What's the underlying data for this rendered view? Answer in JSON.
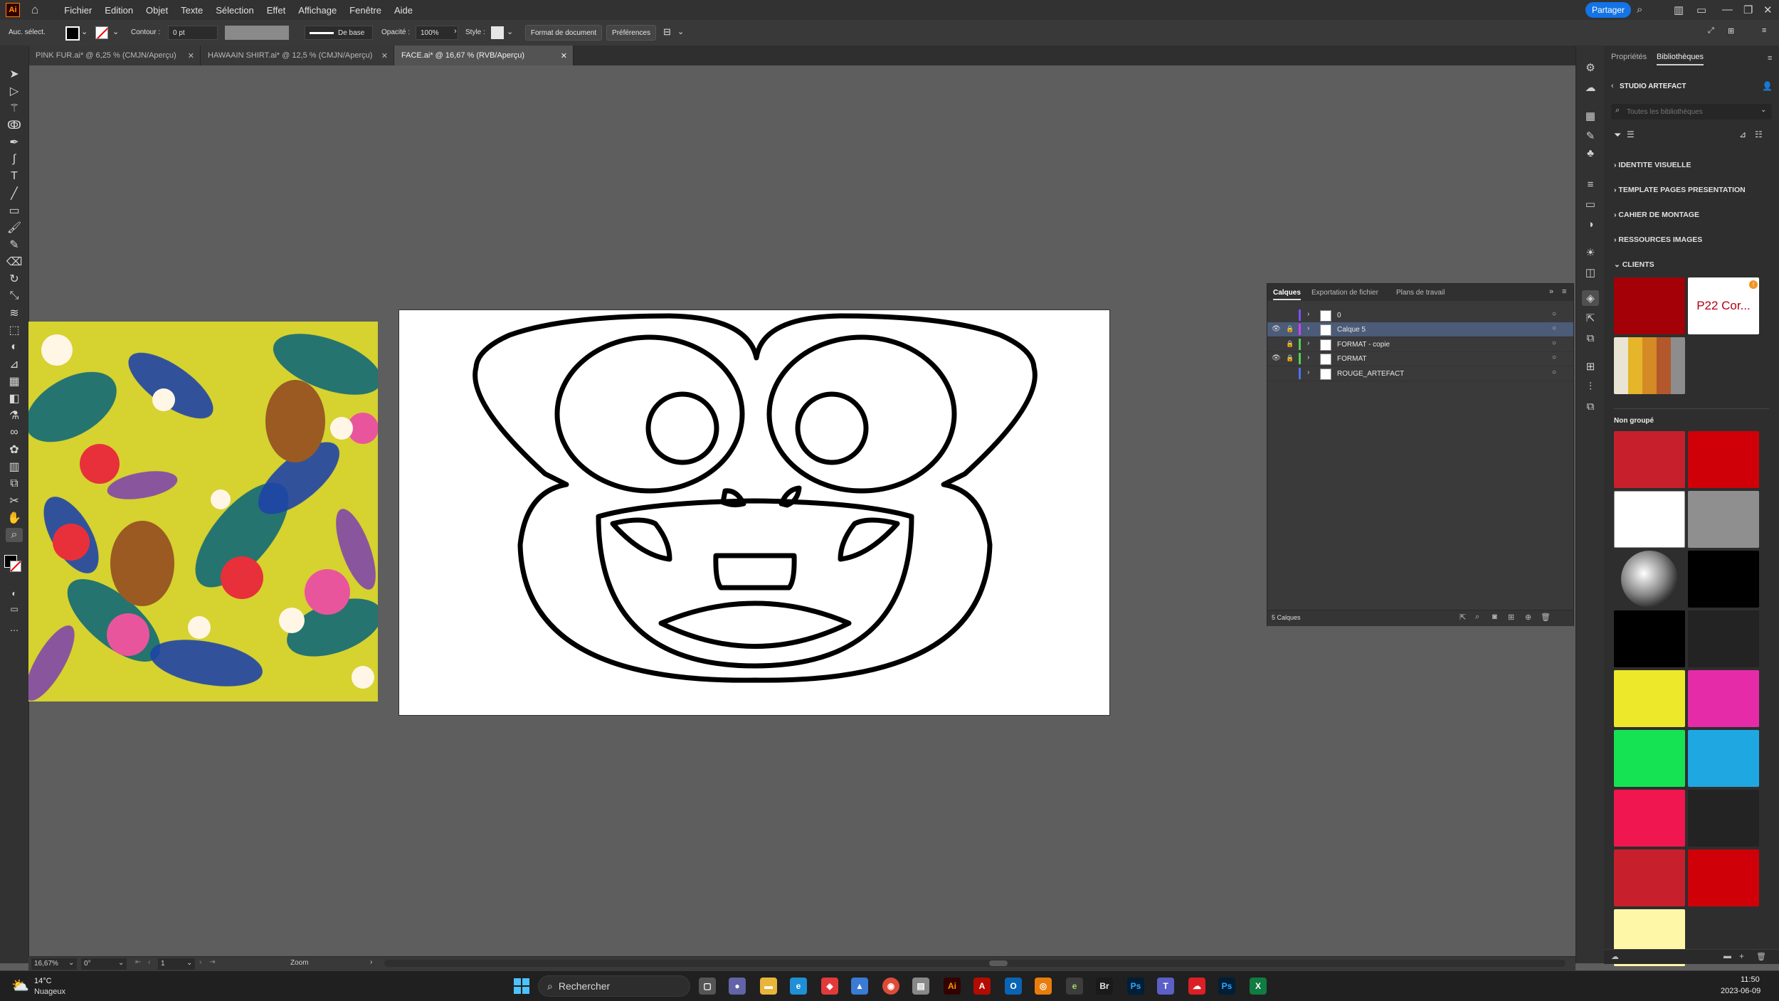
{
  "app": {
    "logo": "Ai"
  },
  "menu": [
    "Fichier",
    "Edition",
    "Objet",
    "Texte",
    "Sélection",
    "Effet",
    "Affichage",
    "Fenêtre",
    "Aide"
  ],
  "share_label": "Partager",
  "control_bar": {
    "selection_label": "Auc. sélect.",
    "contour_label": "Contour :",
    "stroke_weight": "0 pt",
    "stroke_profile": "De base",
    "opacity_label": "Opacité :",
    "opacity_value": "100%",
    "style_label": "Style :",
    "format_button": "Format de document",
    "preferences_button": "Préférences"
  },
  "doc_tabs": [
    {
      "label": "PINK FUR.ai* @ 6,25 % (CMJN/Aperçu)"
    },
    {
      "label": "HAWAAIN SHIRT.ai* @ 12,5 % (CMJN/Aperçu)"
    },
    {
      "label": "FACE.ai* @ 16,67 % (RVB/Aperçu)",
      "active": true
    }
  ],
  "right_panel": {
    "tabs": [
      "Propriétés",
      "Bibliothèques"
    ],
    "library_name": "STUDIO ARTEFACT",
    "search_placeholder": "Toutes les bibliothèques",
    "groups": [
      "IDENTITE VISUELLE",
      "TEMPLATE PAGES PRESENTATION",
      "CAHIER DE MONTAGE",
      "RESSOURCES IMAGES",
      "CLIENTS"
    ],
    "client_card_label": "P22 Cor...",
    "ungrouped_label": "Non groupé",
    "colors": {
      "client_red": "#a30008",
      "swatches": [
        "#c7202c",
        "#d00008",
        "#ffffff",
        "#8f8f8f",
        "#b5b5b5",
        "#000000",
        "#000000",
        "#232323",
        "#eee82a",
        "#e62ba8",
        "#16e354",
        "#1fa7e2",
        "#f0164f",
        "#232323",
        "#c7202c",
        "#d00008",
        "#fff7a8"
      ]
    }
  },
  "layers_panel": {
    "tabs": [
      "Calques",
      "Exportation de fichier",
      "Plans de travail"
    ],
    "layers": [
      {
        "name": "0",
        "visible": false,
        "locked": false,
        "color": "#7a50ff"
      },
      {
        "name": "Calque 5",
        "visible": true,
        "locked": true,
        "color": "#d33cff",
        "selected": true
      },
      {
        "name": "FORMAT - copie",
        "visible": false,
        "locked": true,
        "color": "#4fd14f"
      },
      {
        "name": "FORMAT",
        "visible": true,
        "locked": true,
        "color": "#4fd14f"
      },
      {
        "name": "ROUGE_ARTEFACT",
        "visible": false,
        "locked": false,
        "color": "#4f6fff"
      }
    ],
    "count": "5 Calques"
  },
  "status_bar": {
    "zoom": "16,67%",
    "rotation": "0°",
    "artboard": "1",
    "tool": "Zoom"
  },
  "taskbar": {
    "weather_temp": "14°C",
    "weather_text": "Nuageux",
    "search_label": "Rechercher",
    "time": "11:50",
    "date": "2023-06-09"
  }
}
